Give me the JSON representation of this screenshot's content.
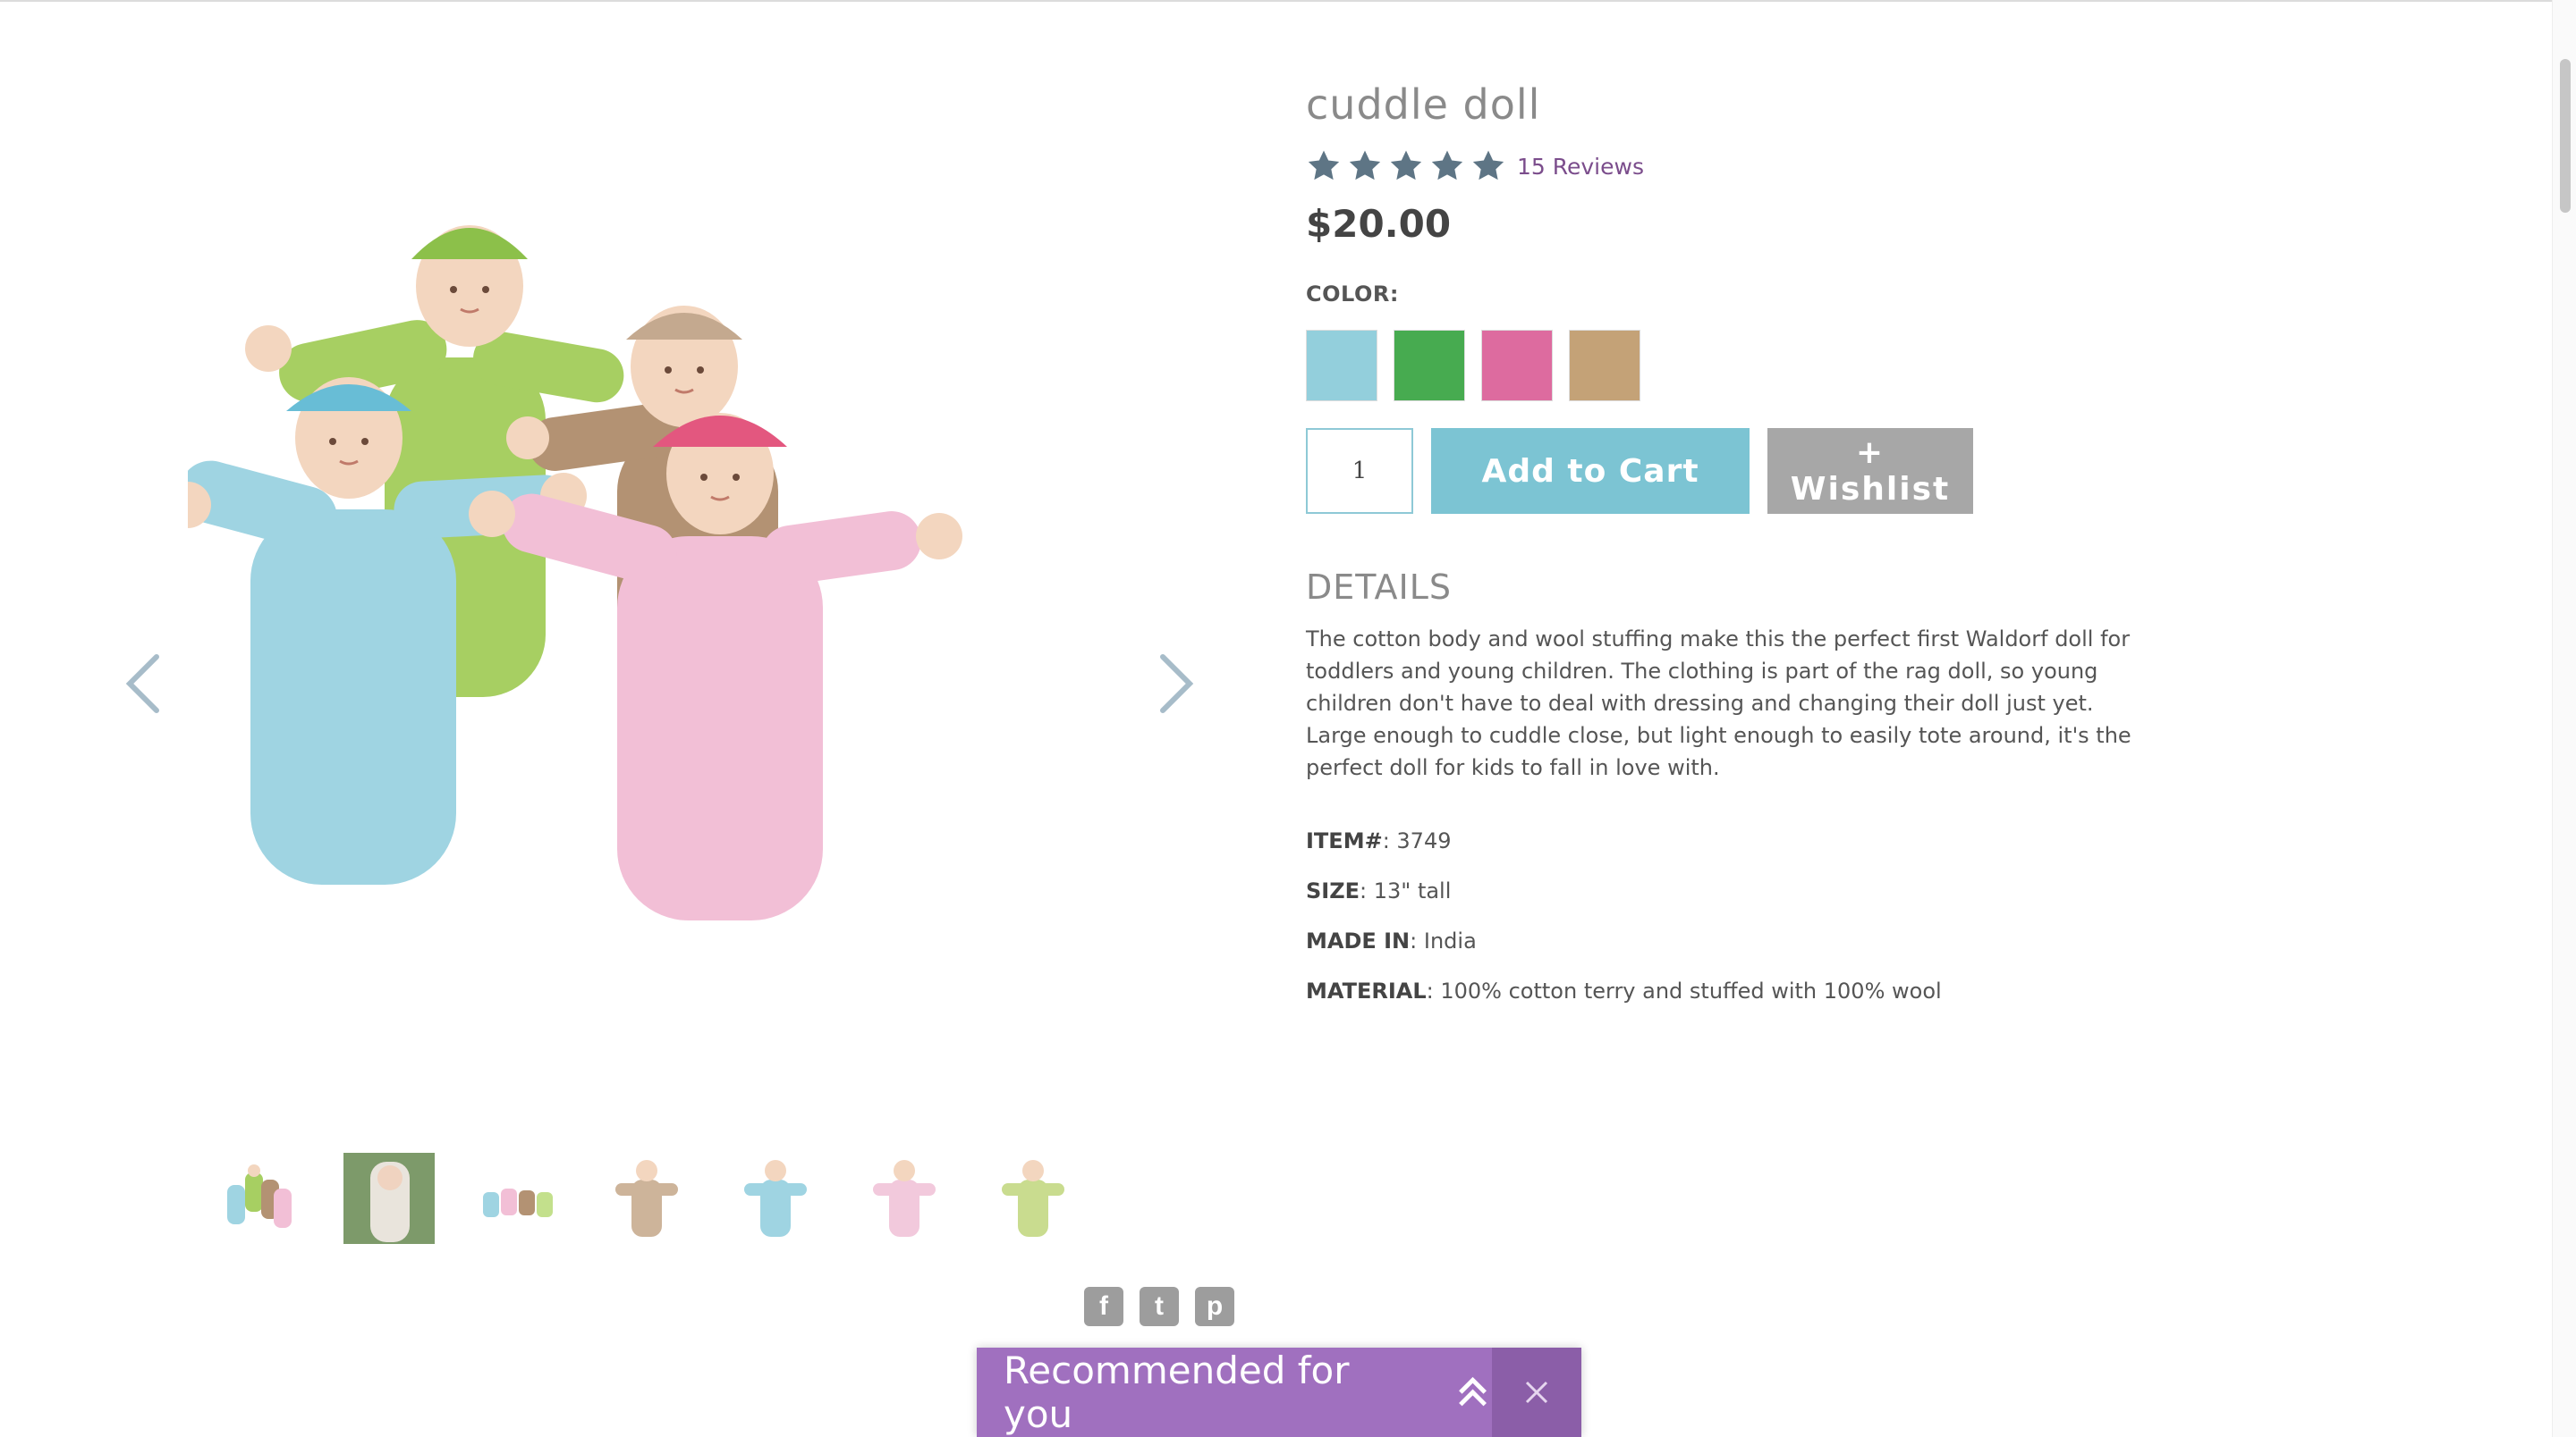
{
  "product": {
    "title": "cuddle doll",
    "rating": 5,
    "rating_max": 5,
    "reviews_label": "15 Reviews",
    "price": "$20.00",
    "color_label": "COLOR:",
    "colors": [
      "#93cfdc",
      "#47ab50",
      "#dd6b9f",
      "#c4a277"
    ],
    "quantity": "1",
    "add_to_cart_label": "Add to Cart",
    "wishlist_label": "+ Wishlist",
    "details_heading": "DETAILS",
    "details_text": "The cotton body and wool stuffing make this the perfect first Waldorf doll for toddlers and young children. The clothing is part of the rag doll, so young children don't have to deal with dressing and changing their doll just yet. Large enough to cuddle close, but light enough to easily tote around, it's the perfect doll for kids to fall in love with.",
    "specs": [
      {
        "label": "ITEM#",
        "value": ": 3749"
      },
      {
        "label": "SIZE",
        "value": ": 13\" tall"
      },
      {
        "label": "MADE IN",
        "value": ": India"
      },
      {
        "label": "MATERIAL",
        "value": ": 100% cotton terry and stuffed with 100% wool"
      }
    ]
  },
  "gallery": {
    "thumbnail_colors": [
      "mixed",
      "photo",
      "mixed",
      "tan",
      "blue",
      "pink",
      "green"
    ]
  },
  "share": {
    "icons": [
      "facebook-icon",
      "twitter-icon",
      "pinterest-icon"
    ],
    "facebook_glyph": "f",
    "twitter_glyph": "t",
    "pinterest_glyph": "p"
  },
  "recommended": {
    "label": "Recommended for you"
  },
  "theme": {
    "accent_purple": "#a070bf",
    "cart_blue": "#7cc4d3",
    "star_color": "#5e7585",
    "review_link": "#7b4d8c"
  }
}
